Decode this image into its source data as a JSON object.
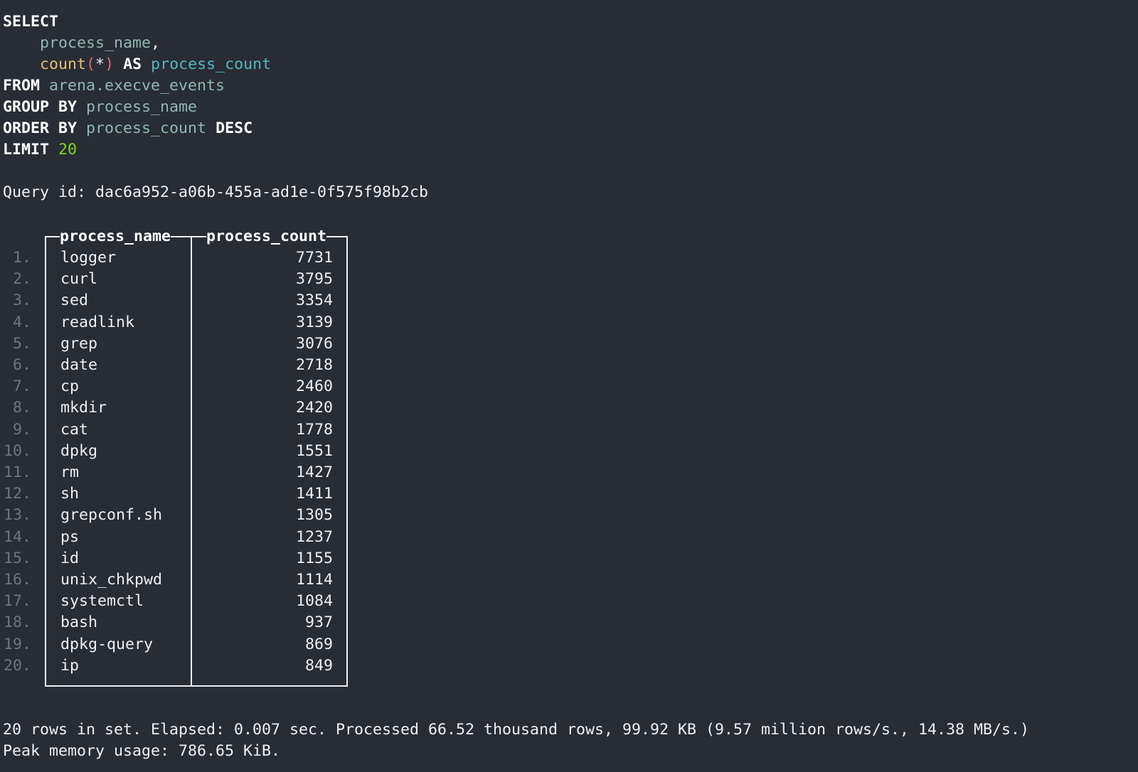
{
  "query": {
    "select_kw": "SELECT",
    "col1": "process_name",
    "comma": ",",
    "func": "count",
    "paren_open": "(",
    "star": "*",
    "paren_close": ")",
    "as_kw": "AS",
    "alias": "process_count",
    "from_kw": "FROM",
    "table": "arena.execve_events",
    "group_kw": "GROUP BY",
    "group_col": "process_name",
    "order_kw": "ORDER BY",
    "order_col": "process_count",
    "desc_kw": "DESC",
    "limit_kw": "LIMIT",
    "limit_val": "20"
  },
  "query_id_line": "Query id: dac6a952-a06b-455a-ad1e-0f575f98b2cb",
  "table": {
    "columns": [
      "process_name",
      "process_count"
    ],
    "rows": [
      {
        "n": "1.",
        "name": "logger",
        "count": "7731"
      },
      {
        "n": "2.",
        "name": "curl",
        "count": "3795"
      },
      {
        "n": "3.",
        "name": "sed",
        "count": "3354"
      },
      {
        "n": "4.",
        "name": "readlink",
        "count": "3139"
      },
      {
        "n": "5.",
        "name": "grep",
        "count": "3076"
      },
      {
        "n": "6.",
        "name": "date",
        "count": "2718"
      },
      {
        "n": "7.",
        "name": "cp",
        "count": "2460"
      },
      {
        "n": "8.",
        "name": "mkdir",
        "count": "2420"
      },
      {
        "n": "9.",
        "name": "cat",
        "count": "1778"
      },
      {
        "n": "10.",
        "name": "dpkg",
        "count": "1551"
      },
      {
        "n": "11.",
        "name": "rm",
        "count": "1427"
      },
      {
        "n": "12.",
        "name": "sh",
        "count": "1411"
      },
      {
        "n": "13.",
        "name": "grepconf.sh",
        "count": "1305"
      },
      {
        "n": "14.",
        "name": "ps",
        "count": "1237"
      },
      {
        "n": "15.",
        "name": "id",
        "count": "1155"
      },
      {
        "n": "16.",
        "name": "unix_chkpwd",
        "count": "1114"
      },
      {
        "n": "17.",
        "name": "systemctl",
        "count": "1084"
      },
      {
        "n": "18.",
        "name": "bash",
        "count": "937"
      },
      {
        "n": "19.",
        "name": "dpkg-query",
        "count": "869"
      },
      {
        "n": "20.",
        "name": "ip",
        "count": "849"
      }
    ]
  },
  "summary_line": "20 rows in set. Elapsed: 0.007 sec. Processed 66.52 thousand rows, 99.92 KB (9.57 million rows/s., 14.38 MB/s.)",
  "memory_line": "Peak memory usage: 786.65 KiB."
}
